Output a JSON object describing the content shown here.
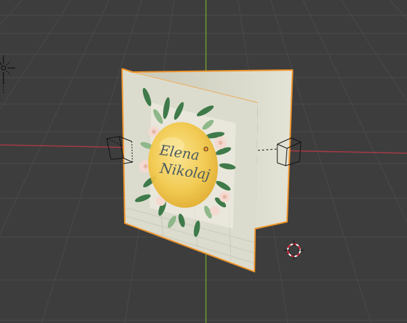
{
  "viewport": {
    "kind": "3d-viewport"
  },
  "object": {
    "name_line1": "Elena",
    "name_line2": "Nikolaj"
  },
  "colors": {
    "background": "#3d3d3d",
    "grid": "#4a4a4a",
    "x_axis": "#a83a45",
    "y_axis": "#6f9a31",
    "selection_outline": "#f0952a",
    "card": "#dcdcce",
    "egg": "#f2c94c",
    "text": "#4a5a62"
  },
  "icons": [
    "light-icon",
    "camera-icon",
    "3d-cursor-icon",
    "origin-icon"
  ]
}
